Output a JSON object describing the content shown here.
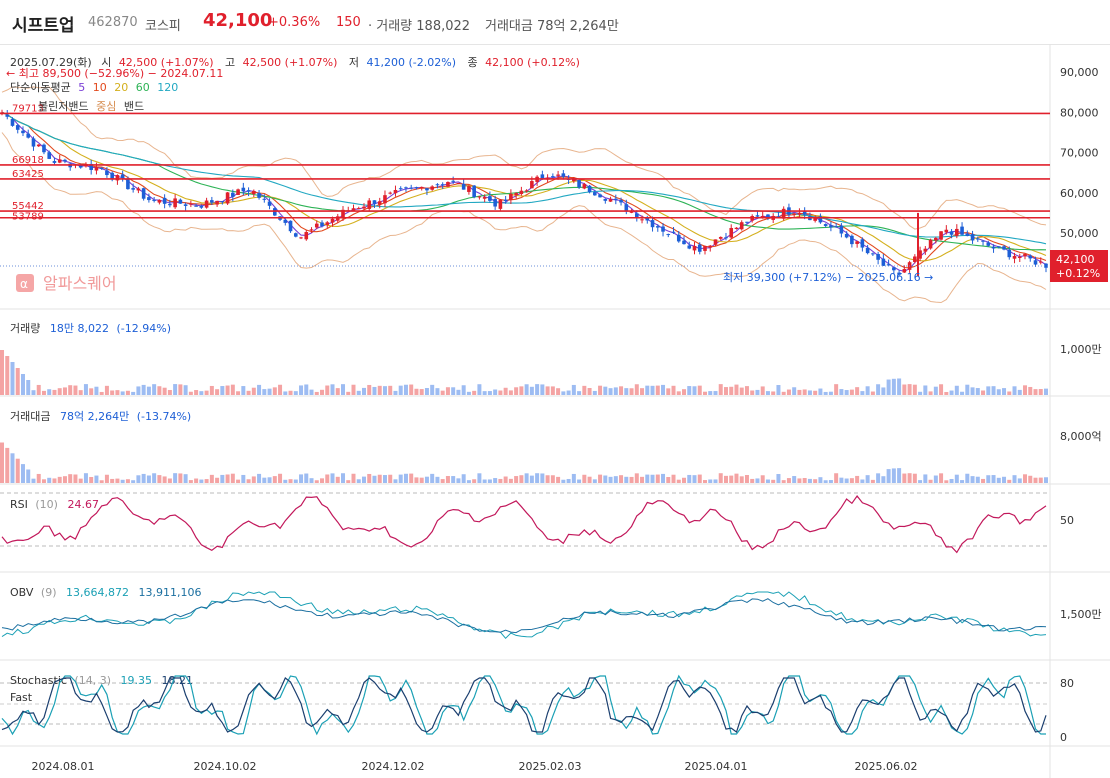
{
  "header": {
    "name": "시프트업",
    "code": "462870",
    "market": "코스피",
    "price": "42,100",
    "change_pct": "+0.36%",
    "change_abs": "150",
    "volume_text": "· 거래량 188,022",
    "amount_text": "거래대금 78억 2,264만"
  },
  "ohlc": {
    "date": "2025.07.29(화)",
    "open_label": "시",
    "open": "42,500 (+1.07%)",
    "high_label": "고",
    "high": "42,500 (+1.07%)",
    "low_label": "저",
    "low": "41,200 (-2.02%)",
    "close_label": "종",
    "close": "42,100 (+0.12%)"
  },
  "annotations": {
    "max": "← 최고 89,500 (−52.96%) − 2024.07.11",
    "min": "최저 39,300 (+7.12%) − 2025.06.16 →",
    "ma_title": "단순이동평균",
    "ma_periods": [
      "5",
      "10",
      "20",
      "60",
      "120"
    ],
    "bb_title": "볼린저밴드",
    "bb_center": "중심",
    "bb_band": "밴드",
    "watermark": "알파스퀘어",
    "price_tag": "42,100",
    "price_tag_pct": "+0.12%"
  },
  "hlines": {
    "labels": [
      "79713",
      "66918",
      "63425",
      "55442",
      "53789"
    ]
  },
  "panels": {
    "volume": {
      "label": "거래량",
      "value": "18만 8,022",
      "change": "(-12.94%)",
      "axis": "1,000만"
    },
    "amount": {
      "label": "거래대금",
      "value": "78억 2,264만",
      "change": "(-13.74%)",
      "axis": "8,000억"
    },
    "rsi": {
      "label": "RSI",
      "param": "(10)",
      "value": "24.67",
      "axis": "50"
    },
    "obv": {
      "label": "OBV",
      "param": "(9)",
      "value1": "13,664,872",
      "value2": "13,911,106",
      "axis": "1,500만"
    },
    "stoch": {
      "label": "Stochastic",
      "param": "(14, 3)",
      "value1": "19.35",
      "value2": "18.21",
      "sublabel": "Fast",
      "axis_hi": "80",
      "axis_lo": "0"
    }
  },
  "chart_data": {
    "type": "line",
    "title": "",
    "y_ticks": [
      "90,000",
      "80,000",
      "70,000",
      "60,000",
      "50,000"
    ],
    "y_tick_values": [
      90000,
      80000,
      70000,
      60000,
      50000
    ],
    "ylim": [
      38000,
      93000
    ],
    "x_ticks": [
      "2024.08.01",
      "2024.10.02",
      "2024.12.02",
      "2025.02.03",
      "2025.04.01",
      "2025.06.02"
    ],
    "hlines_values": [
      79713,
      66918,
      63425,
      55442,
      53789
    ],
    "dates": [
      "2024.07.11",
      "2024.08.01",
      "2024.08.20",
      "2024.09.10",
      "2024.10.02",
      "2024.10.25",
      "2024.11.15",
      "2024.12.02",
      "2024.12.20",
      "2025.01.10",
      "2025.02.03",
      "2025.02.20",
      "2025.03.10",
      "2025.04.01",
      "2025.04.10",
      "2025.04.25",
      "2025.05.15",
      "2025.06.02",
      "2025.06.16",
      "2025.06.25",
      "2025.07.10",
      "2025.07.29"
    ],
    "series": [
      {
        "name": "종",
        "values": [
          80000,
          68000,
          66000,
          58000,
          57000,
          61000,
          49000,
          56000,
          60000,
          63000,
          57000,
          65000,
          60000,
          53000,
          46000,
          53000,
          56000,
          49000,
          39300,
          51000,
          46000,
          42100
        ]
      }
    ]
  },
  "colors": {
    "up": "#e0202c",
    "down": "#1d5fd6",
    "ma5": "#7a3fd6",
    "ma10": "#e24a1e",
    "ma20": "#d4b01e",
    "ma60": "#2eb356",
    "ma120": "#22a8c2",
    "rsi": "#c2185b",
    "obv": "#1ba0b5",
    "stoch": "#1b6fa0"
  }
}
